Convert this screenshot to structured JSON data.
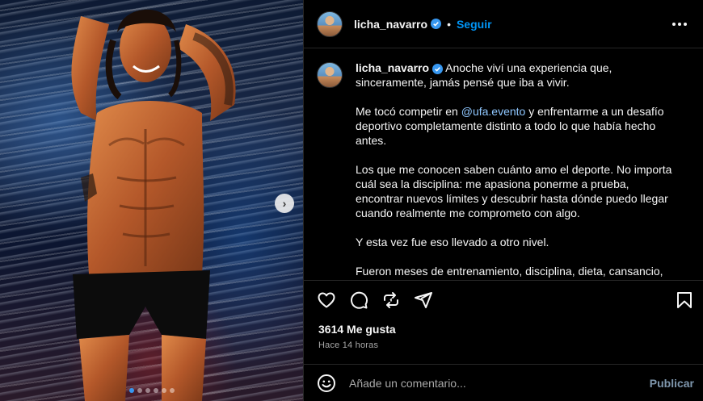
{
  "post": {
    "username": "licha_navarro",
    "separator": "•",
    "follow_label": "Seguir",
    "more_icon": "more-horizontal-icon",
    "verified_color": "#3797f0"
  },
  "caption": {
    "username": "licha_navarro",
    "paragraphs": [
      {
        "text": " Anoche viví una experiencia que, sinceramente, jamás pensé que iba a vivir."
      }
    ],
    "p2_before": "Me tocó competir en ",
    "p2_mention": "@ufa.evento",
    "p2_after": " y enfrentarme a un desafío deportivo completamente distinto a todo lo que había hecho antes.",
    "p3": "Los que me conocen saben cuánto amo el deporte. No importa cuál sea la disciplina: me apasiona ponerme a prueba, encontrar nuevos límites y descubrir hasta dónde puedo llegar cuando realmente me comprometo con algo.",
    "p4": "Y esta vez fue eso llevado a otro nivel.",
    "p5": "Fueron meses de entrenamiento, disciplina, dieta, cansancio,"
  },
  "actions": {
    "like_icon": "heart-icon",
    "comment_icon": "comment-icon",
    "repost_icon": "repost-icon",
    "share_icon": "share-icon",
    "save_icon": "bookmark-icon"
  },
  "likes_text": "3614 Me gusta",
  "time_text": "Hace 14 horas",
  "comment": {
    "placeholder": "Añade un comentario...",
    "publish_label": "Publicar",
    "emoji_icon": "emoji-icon"
  },
  "carousel": {
    "total": 6,
    "active_index": 0,
    "next_icon": "chevron-right-icon"
  },
  "colors": {
    "accent": "#0095f6",
    "background": "#000000",
    "text": "#f5f5f5",
    "muted": "#a8a8a8"
  }
}
